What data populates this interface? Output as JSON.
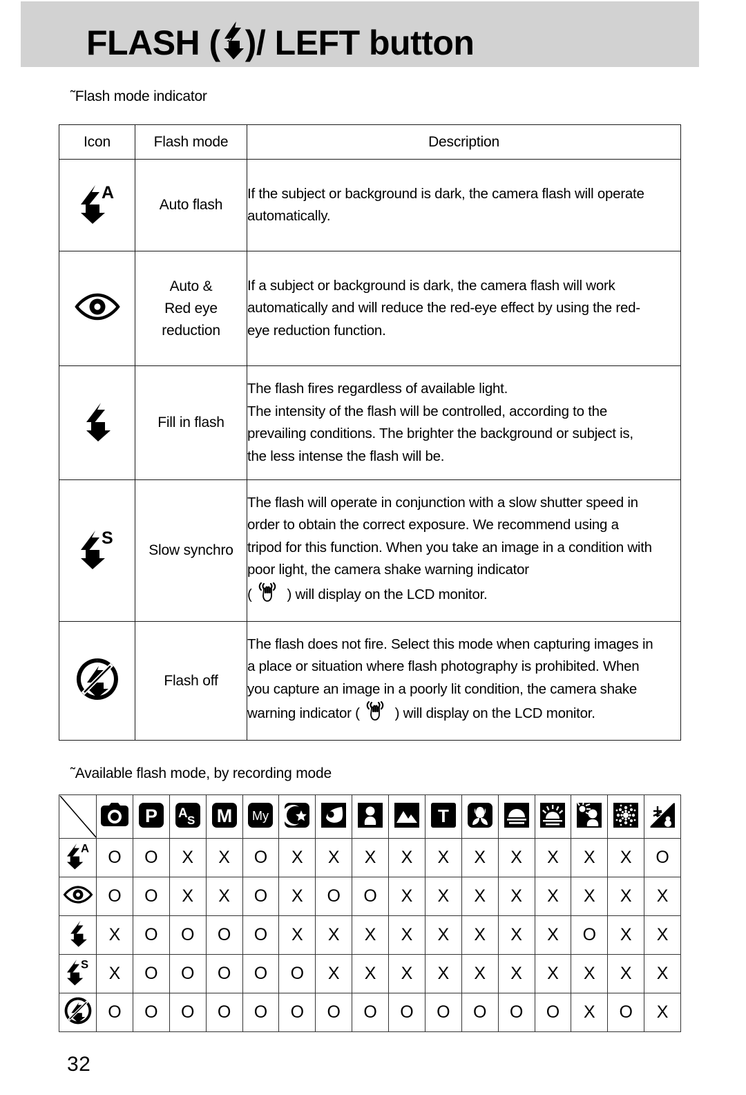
{
  "header": {
    "title_prefix": "FLASH ( ",
    "title_suffix": " )/ LEFT button",
    "icon": "flash-bolt-icon"
  },
  "captions": {
    "section1": "˜Flash mode indicator",
    "section2": "˜Available flash mode, by recording mode"
  },
  "flash_mode_table": {
    "headers": [
      "Icon",
      "Flash mode",
      "Description"
    ],
    "rows": [
      {
        "icon": "flash-auto-icon",
        "mode": "Auto flash",
        "description_lines": [
          "If the subject or background is dark, the camera flash will operate",
          "automatically."
        ]
      },
      {
        "icon": "red-eye-reduction-icon",
        "mode_lines": [
          "Auto &",
          "Red eye",
          "reduction"
        ],
        "description_lines": [
          "If a subject or background is dark, the camera flash will work",
          "automatically and will reduce the red-eye effect by using the red-",
          "eye reduction function."
        ]
      },
      {
        "icon": "flash-fill-icon",
        "mode": "Fill in flash",
        "description_lines": [
          "The flash fires regardless of available light.",
          "The intensity of the flash will be controlled, according to the",
          "prevailing conditions. The brighter the background or subject is,",
          "the less intense the flash will be."
        ]
      },
      {
        "icon": "flash-slow-synchro-icon",
        "mode": "Slow synchro",
        "description_lines": [
          "The flash will operate in conjunction with a slow shutter speed in",
          "order to obtain the correct exposure. We recommend using a",
          "tripod for this function. When you take an image in a condition with",
          "poor light, the camera shake warning indicator"
        ],
        "description_tail_before": "(",
        "description_tail_icon": "camera-shake-icon",
        "description_tail_after": ") will display on the LCD monitor."
      },
      {
        "icon": "flash-off-icon",
        "mode": "Flash off",
        "description_lines": [
          "The flash does not fire. Select this mode when capturing images in",
          "a place or situation where flash photography is prohibited. When",
          "you capture an image in a poorly lit condition, the camera shake"
        ],
        "description_tail_before": "warning indicator (",
        "description_tail_icon": "camera-shake-icon",
        "description_tail_after": ") will display on the LCD monitor."
      }
    ]
  },
  "availability_table": {
    "corner": "diagonal-divider",
    "column_modes": [
      "auto-camera-mode-icon",
      "program-mode-icon",
      "aperture-shutter-priority-mode-icon",
      "manual-mode-icon",
      "my-set-mode-icon",
      "night-scene-mode-icon",
      "portrait-mode-icon",
      "children-mode-icon",
      "landscape-mode-icon",
      "text-mode-icon",
      "close-up-mode-icon",
      "sunset-mode-icon",
      "dawn-mode-icon",
      "backlight-mode-icon",
      "fireworks-mode-icon",
      "beach-snow-mode-icon"
    ],
    "row_modes": [
      "flash-auto-icon",
      "red-eye-reduction-icon",
      "flash-fill-icon",
      "flash-slow-synchro-icon",
      "flash-off-icon"
    ],
    "values": [
      [
        "O",
        "O",
        "X",
        "X",
        "O",
        "X",
        "X",
        "X",
        "X",
        "X",
        "X",
        "X",
        "X",
        "X",
        "X",
        "O"
      ],
      [
        "O",
        "O",
        "X",
        "X",
        "O",
        "X",
        "O",
        "O",
        "X",
        "X",
        "X",
        "X",
        "X",
        "X",
        "X",
        "X"
      ],
      [
        "X",
        "O",
        "O",
        "O",
        "O",
        "X",
        "X",
        "X",
        "X",
        "X",
        "X",
        "X",
        "X",
        "O",
        "X",
        "X"
      ],
      [
        "X",
        "O",
        "O",
        "O",
        "O",
        "O",
        "X",
        "X",
        "X",
        "X",
        "X",
        "X",
        "X",
        "X",
        "X",
        "X"
      ],
      [
        "O",
        "O",
        "O",
        "O",
        "O",
        "O",
        "O",
        "O",
        "O",
        "O",
        "O",
        "O",
        "O",
        "X",
        "O",
        "X"
      ]
    ]
  },
  "footer": {
    "page_number": "32"
  },
  "colors": {
    "banner_background": "#d2d2d2",
    "text": "#000000",
    "table_border": "#1a1a1a"
  }
}
